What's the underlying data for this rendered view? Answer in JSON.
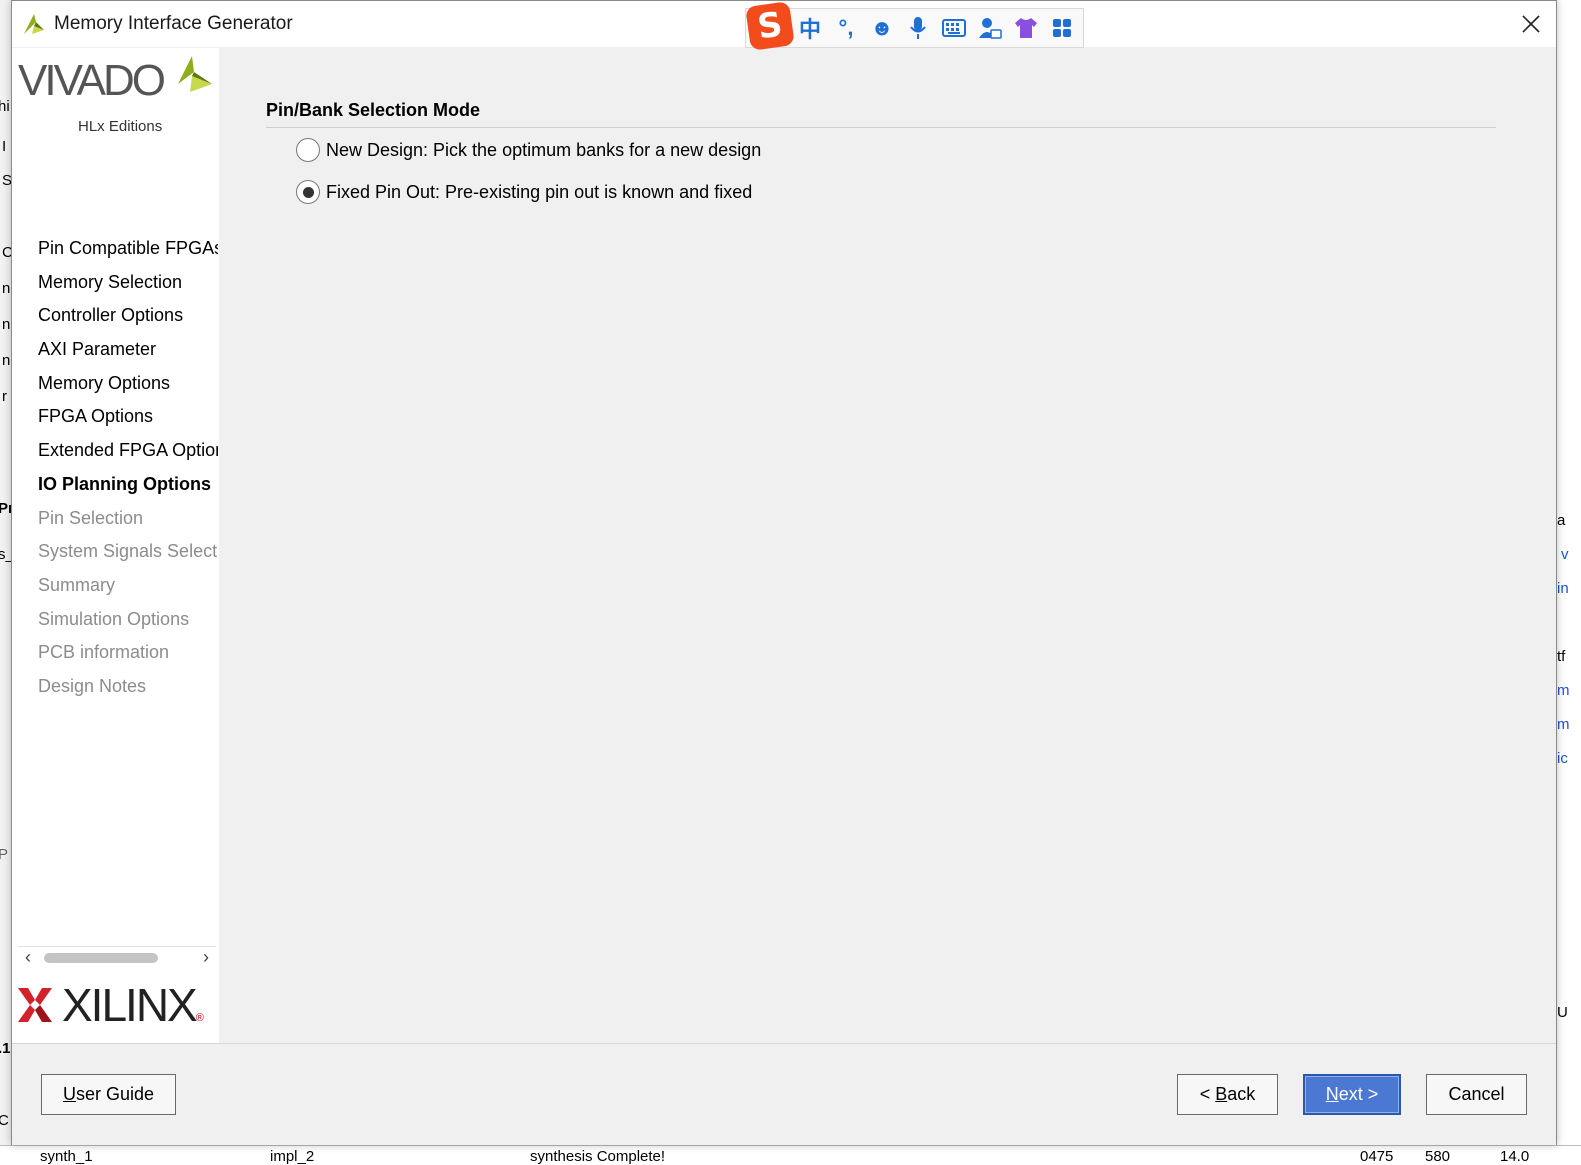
{
  "window": {
    "title": "Memory Interface Generator"
  },
  "ime_toolbar": {
    "logo": "S",
    "items": [
      {
        "name": "chinese-mode-icon",
        "glyph": "中"
      },
      {
        "name": "punctuation-icon",
        "glyph": "°,"
      },
      {
        "name": "emoji-icon",
        "glyph": "☻"
      },
      {
        "name": "microphone-icon",
        "glyph": "🎤"
      },
      {
        "name": "keyboard-icon",
        "glyph": "⌨"
      },
      {
        "name": "user-icon",
        "glyph": "👤"
      },
      {
        "name": "skin-icon",
        "glyph": "👕"
      },
      {
        "name": "apps-icon",
        "glyph": "▦"
      }
    ]
  },
  "branding": {
    "vivado": "VIVADO",
    "vivado_sub": "HLx Editions",
    "xilinx": "XILINX"
  },
  "nav": {
    "items": [
      {
        "label": "Pin Compatible FPGAs",
        "state": "normal"
      },
      {
        "label": "Memory Selection",
        "state": "normal"
      },
      {
        "label": "Controller Options",
        "state": "normal"
      },
      {
        "label": "AXI Parameter",
        "state": "normal"
      },
      {
        "label": "Memory Options",
        "state": "normal"
      },
      {
        "label": "FPGA Options",
        "state": "normal"
      },
      {
        "label": "Extended FPGA Options",
        "state": "normal"
      },
      {
        "label": "IO Planning Options",
        "state": "active"
      },
      {
        "label": "Pin Selection",
        "state": "disabled"
      },
      {
        "label": "System Signals Selection",
        "state": "disabled"
      },
      {
        "label": "Summary",
        "state": "disabled"
      },
      {
        "label": "Simulation Options",
        "state": "disabled"
      },
      {
        "label": "PCB information",
        "state": "disabled"
      },
      {
        "label": "Design Notes",
        "state": "disabled"
      }
    ]
  },
  "main": {
    "section_title": "Pin/Bank Selection Mode",
    "options": [
      {
        "label": "New Design: Pick the optimum banks for a new design",
        "selected": false
      },
      {
        "label": "Fixed Pin Out: Pre-existing pin out is known and fixed",
        "selected": true
      }
    ]
  },
  "footer": {
    "user_guide": {
      "pre": "",
      "mnemonic": "U",
      "post": "ser Guide"
    },
    "back": {
      "pre": "< ",
      "mnemonic": "B",
      "post": "ack"
    },
    "next": {
      "pre": "",
      "mnemonic": "N",
      "post": "ext >"
    },
    "cancel": "Cancel"
  },
  "background_fragments": {
    "left": [
      "hi",
      "I",
      "S",
      "C",
      "n",
      "n",
      "n",
      "r",
      "Pr",
      "s_",
      "P",
      ".1",
      "C"
    ],
    "right": [
      "a",
      "v",
      "in",
      "tf",
      "m",
      "m",
      "ic",
      "U"
    ],
    "bottom": [
      "synth_1",
      "impl_2",
      "synthesis Complete!",
      "0475",
      "580",
      "14.0"
    ]
  },
  "colors": {
    "primary_button": "#4a78d2",
    "ime_brand": "#f24c1d",
    "xilinx_red": "#d4202a",
    "vivado_green": "#a6c51d"
  }
}
